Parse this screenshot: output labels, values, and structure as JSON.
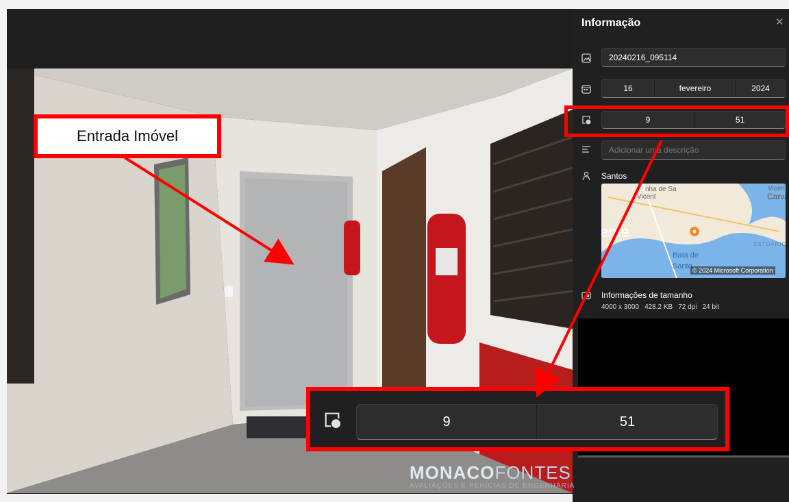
{
  "panel": {
    "title": "Informação",
    "close_label": "✕",
    "filename": "20240216_095114",
    "date": {
      "day": "16",
      "month": "fevereiro",
      "year": "2024"
    },
    "time": {
      "hour": "9",
      "minute": "51"
    },
    "description_placeholder": "Adicionar uma descrição",
    "location": "Santos",
    "map": {
      "labels": [
        "nha de Sa",
        "Vicent",
        "Vicen",
        "Carva",
        "ente",
        "ESTUÁRIO",
        "Baía de",
        "Santo"
      ],
      "copyright": "© 2024 Microsoft Corporation"
    },
    "size_info": {
      "title": "Informações de tamanho",
      "dimensions": "4000 x 3000",
      "filesize": "428.2 KB",
      "dpi": "72 dpi",
      "bitdepth": "24 bit"
    }
  },
  "zoom": {
    "hour": "9",
    "minute": "51"
  },
  "callout": {
    "text": "Entrada Imóvel"
  },
  "watermark": {
    "brand_bold": "MONACO",
    "brand_light": "FONTES",
    "tagline": "AVALIAÇÕES E PERÍCIAS DE ENGENHARIA"
  },
  "icons": [
    "image-icon",
    "calendar-icon",
    "clock-calendar-icon",
    "description-lines-icon",
    "location-person-icon",
    "size-icon",
    "close-icon"
  ],
  "colors": {
    "annotation_red": "#ff0000",
    "panel_bg": "#202020",
    "map_water": "#7bb4e8",
    "map_land": "#f1eadb",
    "pin": "#f08a24"
  }
}
